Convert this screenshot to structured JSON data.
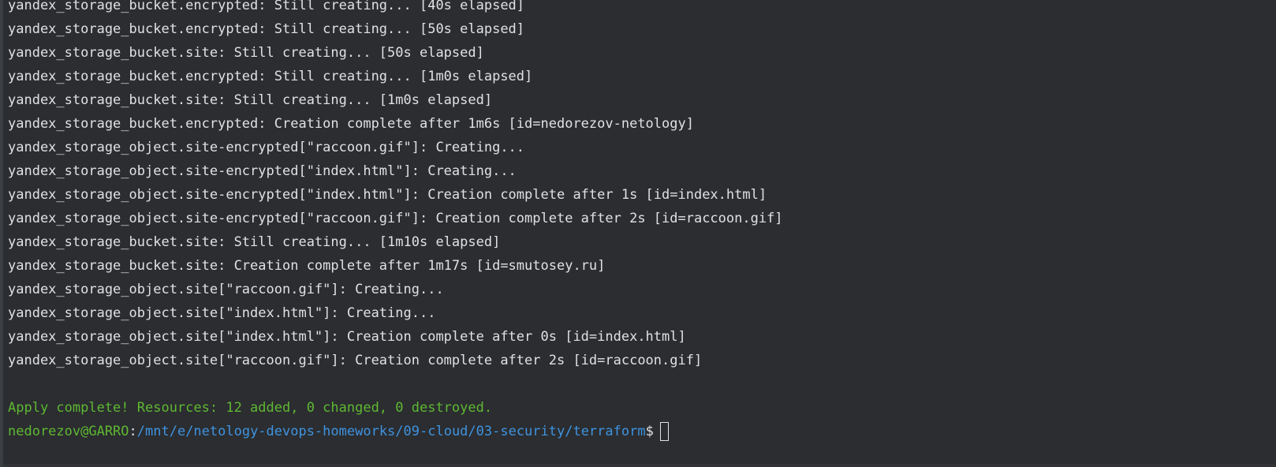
{
  "terminal": {
    "lines": [
      "yandex_storage_bucket.encrypted: Still creating... [40s elapsed]",
      "yandex_storage_bucket.encrypted: Still creating... [50s elapsed]",
      "yandex_storage_bucket.site: Still creating... [50s elapsed]",
      "yandex_storage_bucket.encrypted: Still creating... [1m0s elapsed]",
      "yandex_storage_bucket.site: Still creating... [1m0s elapsed]",
      "yandex_storage_bucket.encrypted: Creation complete after 1m6s [id=nedorezov-netology]",
      "yandex_storage_object.site-encrypted[\"raccoon.gif\"]: Creating...",
      "yandex_storage_object.site-encrypted[\"index.html\"]: Creating...",
      "yandex_storage_object.site-encrypted[\"index.html\"]: Creation complete after 1s [id=index.html]",
      "yandex_storage_object.site-encrypted[\"raccoon.gif\"]: Creation complete after 2s [id=raccoon.gif]",
      "yandex_storage_bucket.site: Still creating... [1m10s elapsed]",
      "yandex_storage_bucket.site: Creation complete after 1m17s [id=smutosey.ru]",
      "yandex_storage_object.site[\"raccoon.gif\"]: Creating...",
      "yandex_storage_object.site[\"index.html\"]: Creating...",
      "yandex_storage_object.site[\"index.html\"]: Creation complete after 0s [id=index.html]",
      "yandex_storage_object.site[\"raccoon.gif\"]: Creation complete after 2s [id=raccoon.gif]"
    ],
    "apply_summary": "Apply complete! Resources: 12 added, 0 changed, 0 destroyed.",
    "prompt": {
      "user_host": "nedorezov@GARRO",
      "separator": ":",
      "path": "/mnt/e/netology-devops-homeworks/09-cloud/03-security/terraform",
      "symbol": "$"
    }
  },
  "colors": {
    "background": "#2b2d30",
    "text": "#dfe1e5",
    "success_green": "#5fb832",
    "path_blue": "#3f93e0"
  }
}
